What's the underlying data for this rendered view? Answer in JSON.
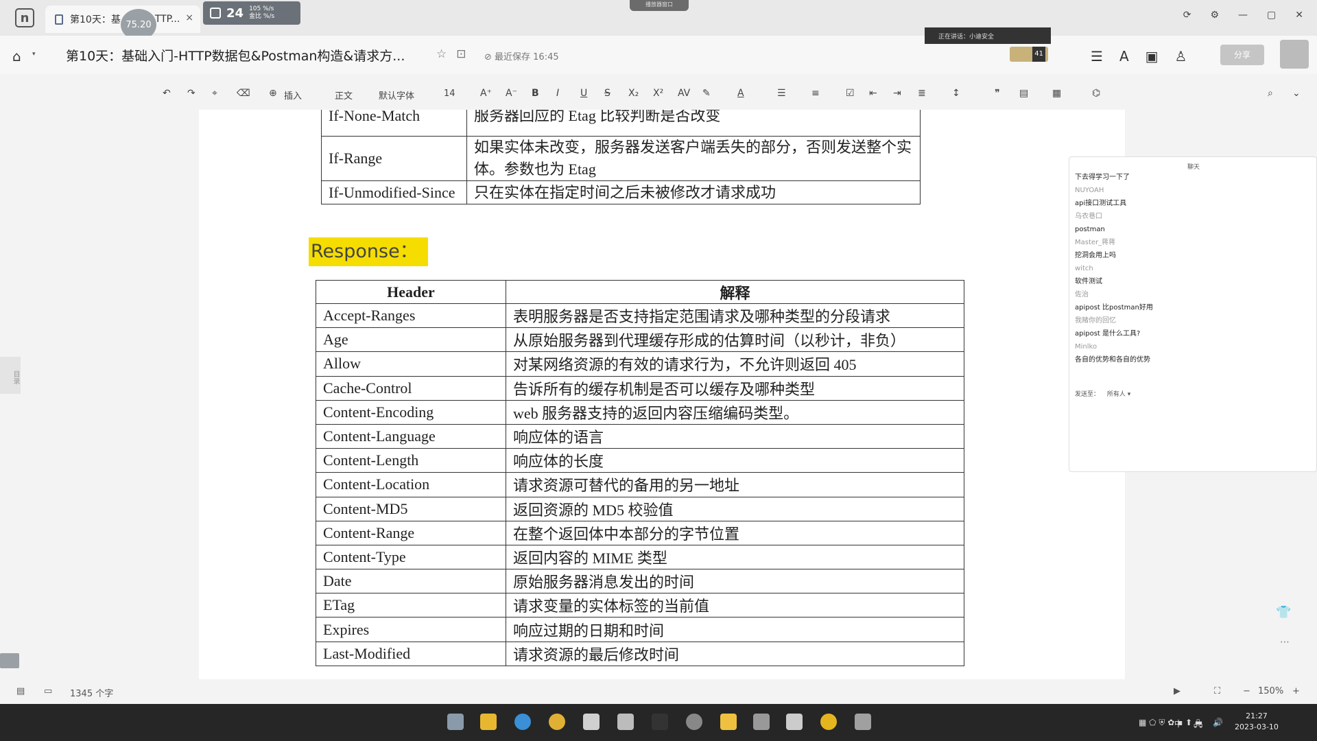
{
  "tab": {
    "label": "第10天：基",
    "label_tail": "TTP...",
    "close": "×"
  },
  "speed_badge": "75.20",
  "net_widget": {
    "value": "24",
    "line1": "105 %/s",
    "line2": "金比 %/s"
  },
  "top_pill": "播放器窗口",
  "window_controls": [
    "⟳",
    "⚙",
    "—",
    "▢",
    "✕"
  ],
  "title_bar": {
    "doc_title": "第10天：基础入门-HTTP数据包&Postman构造&请求方...",
    "saved": "最近保存 16:45"
  },
  "notice": "正在讲话：小迪安全",
  "avatars": {
    "count": "41"
  },
  "share_button": "分享",
  "toolbar": {
    "insert": "插入",
    "style": "正文",
    "font": "默认字体",
    "size": "14"
  },
  "request_rows": [
    {
      "header": "If-None-Match",
      "desc": "服务器回应的 Etag 比较判断是否改变"
    },
    {
      "header": "If-Range",
      "desc": "如果实体未改变，服务器发送客户端丢失的部分，否则发送整个实体。参数也为 Etag"
    },
    {
      "header": "If-Unmodified-Since",
      "desc": "只在实体在指定时间之后未被修改才请求成功"
    }
  ],
  "response_heading": "Response：",
  "response_table": {
    "col_header": "Header",
    "col_desc": "解释",
    "rows": [
      {
        "header": "Accept-Ranges",
        "desc": "表明服务器是否支持指定范围请求及哪种类型的分段请求"
      },
      {
        "header": "Age",
        "desc": "从原始服务器到代理缓存形成的估算时间（以秒计，非负）"
      },
      {
        "header": "Allow",
        "desc": "对某网络资源的有效的请求行为，不允许则返回 405"
      },
      {
        "header": "Cache-Control",
        "desc": "告诉所有的缓存机制是否可以缓存及哪种类型"
      },
      {
        "header": "Content-Encoding",
        "desc": "web 服务器支持的返回内容压缩编码类型。"
      },
      {
        "header": "Content-Language",
        "desc": "响应体的语言"
      },
      {
        "header": "Content-Length",
        "desc": "响应体的长度"
      },
      {
        "header": "Content-Location",
        "desc": "请求资源可替代的备用的另一地址"
      },
      {
        "header": "Content-MD5",
        "desc": "返回资源的 MD5 校验值"
      },
      {
        "header": "Content-Range",
        "desc": "在整个返回体中本部分的字节位置"
      },
      {
        "header": "Content-Type",
        "desc": "返回内容的 MIME 类型"
      },
      {
        "header": "Date",
        "desc": "原始服务器消息发出的时间"
      },
      {
        "header": "ETag",
        "desc": "请求变量的实体标签的当前值"
      },
      {
        "header": "Expires",
        "desc": "响应过期的日期和时间"
      },
      {
        "header": "Last-Modified",
        "desc": "请求资源的最后修改时间"
      }
    ]
  },
  "chat": {
    "title": "聊天",
    "messages": [
      {
        "kind": "msg",
        "text": "下去得学习一下了"
      },
      {
        "kind": "name",
        "text": "NUYOAH"
      },
      {
        "kind": "msg",
        "text": "api接口测试工具"
      },
      {
        "kind": "name",
        "text": "乌衣巷口"
      },
      {
        "kind": "msg",
        "text": "postman"
      },
      {
        "kind": "name",
        "text": "Master_蒋蒋"
      },
      {
        "kind": "msg",
        "text": "挖洞会用上吗"
      },
      {
        "kind": "name",
        "text": "witch"
      },
      {
        "kind": "msg",
        "text": "软件测试"
      },
      {
        "kind": "name",
        "text": "佐治"
      },
      {
        "kind": "msg",
        "text": "apipost 比postman好用"
      },
      {
        "kind": "name",
        "text": "我赌你的回忆"
      },
      {
        "kind": "msg",
        "text": "apipost 是什么工具?"
      },
      {
        "kind": "name",
        "text": "Minlko"
      },
      {
        "kind": "msg",
        "text": "各自的优势和各自的优势"
      }
    ],
    "send_to_label": "发送至：",
    "send_to_value": "所有人"
  },
  "outline_label": "目录",
  "status_bar": {
    "word_count": "1345 个字",
    "zoom": "150%"
  },
  "clock": {
    "time": "21:27",
    "date": "2023-03-10"
  },
  "tray_ime": "中"
}
